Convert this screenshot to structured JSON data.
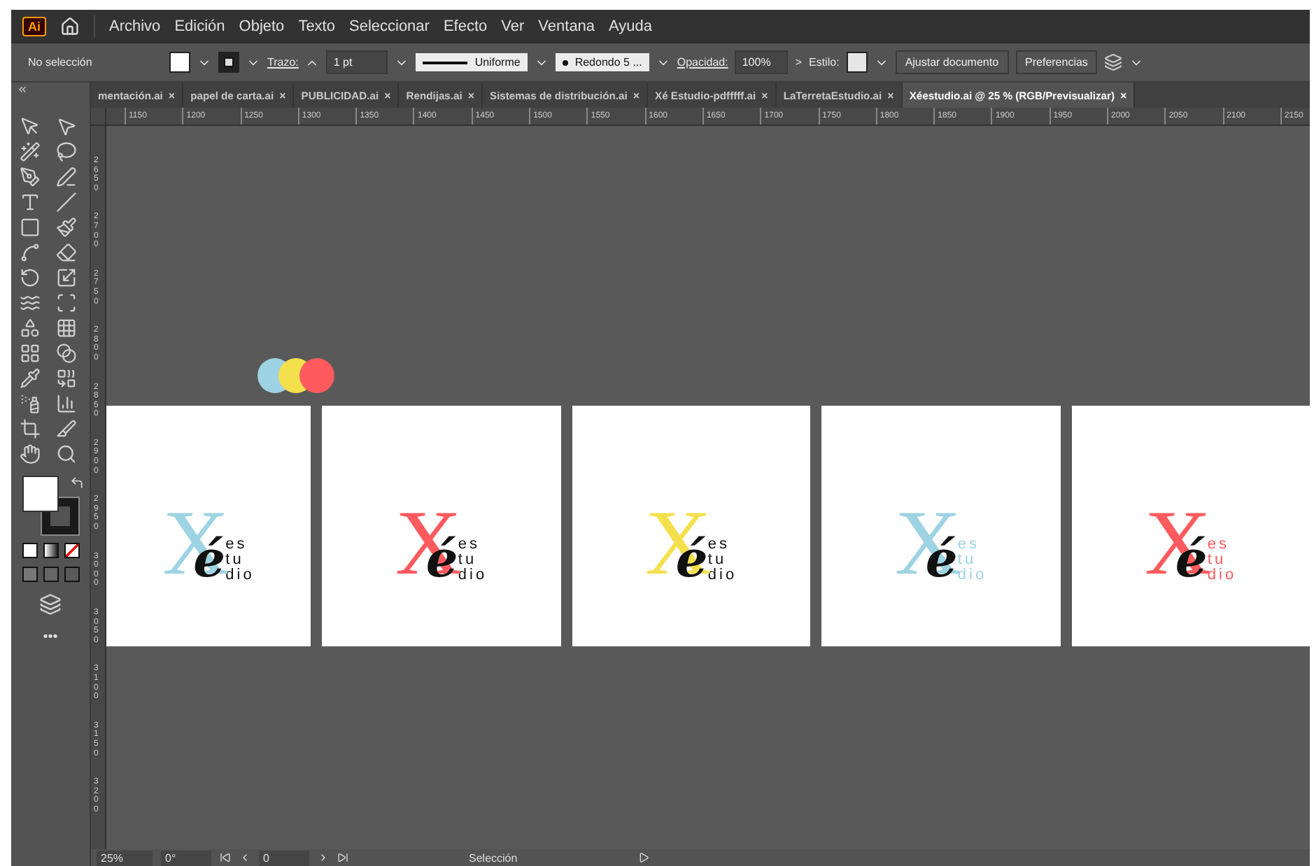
{
  "app_badge": "Ai",
  "menu": [
    "Archivo",
    "Edición",
    "Objeto",
    "Texto",
    "Seleccionar",
    "Efecto",
    "Ver",
    "Ventana",
    "Ayuda"
  ],
  "control_bar": {
    "selection": "No selección",
    "stroke_label": "Trazo:",
    "stroke_weight": "1 pt",
    "profile": "Uniforme",
    "brush": "Redondo 5 ...",
    "opacity_label": "Opacidad:",
    "opacity": "100%",
    "more": ">",
    "style_label": "Estilo:",
    "buttons": [
      "Ajustar documento",
      "Preferencias"
    ]
  },
  "tabs": [
    {
      "label": "mentación.ai",
      "close": "×",
      "selected": false
    },
    {
      "label": "papel de carta.ai",
      "close": "×",
      "selected": false
    },
    {
      "label": "PUBLICIDAD.ai",
      "close": "×",
      "selected": false
    },
    {
      "label": "Rendijas.ai",
      "close": "×",
      "selected": false
    },
    {
      "label": "Sistemas de distribución.ai",
      "close": "×",
      "selected": false
    },
    {
      "label": "Xé Estudio-pdfffff.ai",
      "close": "×",
      "selected": false
    },
    {
      "label": "LaTerretaEstudio.ai",
      "close": "×",
      "selected": false
    },
    {
      "label": "Xéestudio.ai @ 25 % (RGB/Previsualizar)",
      "close": "×",
      "selected": true
    }
  ],
  "ruler": {
    "horizontal": [
      "1150",
      "1200",
      "1250",
      "1300",
      "1350",
      "1400",
      "1450",
      "1500",
      "1550",
      "1600",
      "1650",
      "1700",
      "1750",
      "1800",
      "1850",
      "1900",
      "1950",
      "2000",
      "2050",
      "2100",
      "2150"
    ],
    "vertical": [
      "2650",
      "2700",
      "2750",
      "2800",
      "2850",
      "2900",
      "2950",
      "3000",
      "3050",
      "3100",
      "3150",
      "3200"
    ]
  },
  "toolbar": {
    "more": "•••"
  },
  "color_dots": [
    {
      "color": "#9dd3e3"
    },
    {
      "color": "#f4e04d"
    },
    {
      "color": "#ff5b5f"
    }
  ],
  "artboards": [
    {
      "letter": "X",
      "accent": "é",
      "lines": [
        "es",
        "tu",
        "dio"
      ],
      "color": "#9dd3e3",
      "words_colored": false
    },
    {
      "letter": "X",
      "accent": "é",
      "lines": [
        "es",
        "tu",
        "dio"
      ],
      "color": "#ff5b5f",
      "words_colored": false
    },
    {
      "letter": "X",
      "accent": "é",
      "lines": [
        "es",
        "tu",
        "dio"
      ],
      "color": "#f4e04d",
      "words_colored": false
    },
    {
      "letter": "X",
      "accent": "é",
      "lines": [
        "es",
        "tu",
        "dio"
      ],
      "color": "#9dd3e3",
      "words_colored": true
    },
    {
      "letter": "X",
      "accent": "é",
      "lines": [
        "es",
        "tu",
        "dio"
      ],
      "color": "#ff5b5f",
      "words_colored": true
    }
  ],
  "status_bar": {
    "zoom": "25%",
    "rotation": "0°",
    "artboard": "0",
    "tool": "Selección"
  }
}
